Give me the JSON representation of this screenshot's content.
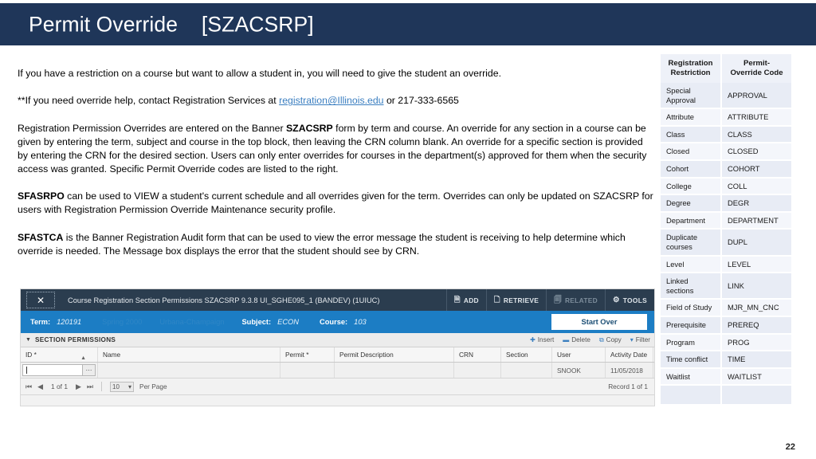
{
  "slide": {
    "title_main": "Permit Override",
    "title_code": "[SZACSRP]",
    "number": "22"
  },
  "body": {
    "p1": "If you have a restriction on a course but want to allow a student in, you will need to give the student an override.",
    "p2_pre": "**If you need override help, contact Registration Services at ",
    "p2_link": "registration@Illinois.edu",
    "p2_post": " or 217-333-6565",
    "p3_pre": "Registration Permission Overrides are entered on the Banner ",
    "p3_bold": "SZACSRP",
    "p3_post": " form by term and course.  An override for any section in a course can be given by entering the term, subject and course in the top block, then leaving the CRN column blank.  An override for a specific section is provided by entering the CRN for the desired section. Users can only enter overrides for courses in the department(s) approved for them when the security access was granted. Specific Permit Override codes are listed to the right.",
    "p4_bold": "SFASRPO",
    "p4_post": " can be used to VIEW a student's current schedule and all overrides given for the term.  Overrides can only be updated on SZACSRP for users with Registration Permission Override Maintenance security profile.",
    "p5_bold": "SFASTCA",
    "p5_post": " is the Banner Registration Audit form that can be used to view the error message the student is receiving to help determine which override is needed.  The Message box displays the error that the student should see by CRN."
  },
  "code_table": {
    "headers": [
      "Registration Restriction",
      "Permit-Override Code"
    ],
    "header_lines": [
      [
        "Registration",
        "Restriction"
      ],
      [
        "Permit-",
        "Override Code"
      ]
    ],
    "rows": [
      {
        "restriction": "Special Approval",
        "code": "APPROVAL"
      },
      {
        "restriction": "Attribute",
        "code": "ATTRIBUTE"
      },
      {
        "restriction": "Class",
        "code": "CLASS"
      },
      {
        "restriction": "Closed",
        "code": "CLOSED"
      },
      {
        "restriction": "Cohort",
        "code": "COHORT"
      },
      {
        "restriction": "College",
        "code": "COLL"
      },
      {
        "restriction": "Degree",
        "code": "DEGR"
      },
      {
        "restriction": "Department",
        "code": "DEPARTMENT"
      },
      {
        "restriction": "Duplicate courses",
        "code": "DUPL"
      },
      {
        "restriction": "Level",
        "code": "LEVEL"
      },
      {
        "restriction": "Linked sections",
        "code": "LINK"
      },
      {
        "restriction": "Field of Study",
        "code": "MJR_MN_CNC"
      },
      {
        "restriction": "Prerequisite",
        "code": "PREREQ"
      },
      {
        "restriction": "Program",
        "code": "PROG"
      },
      {
        "restriction": "Time conflict",
        "code": "TIME"
      },
      {
        "restriction": "Waitlist",
        "code": "WAITLIST"
      },
      {
        "restriction": "",
        "code": ""
      }
    ]
  },
  "banner": {
    "close_glyph": "✕",
    "window_title": "Course Registration Section Permissions SZACSRP 9.3.8 UI_SGHE095_1 (BANDEV) (1UIUC)",
    "actions": [
      {
        "label": "ADD",
        "glyph": "🗎",
        "disabled": false
      },
      {
        "label": "RETRIEVE",
        "glyph": "🗋",
        "disabled": false
      },
      {
        "label": "RELATED",
        "glyph": "🗐",
        "disabled": true
      },
      {
        "label": "TOOLS",
        "glyph": "⚙",
        "disabled": false
      }
    ],
    "keyblock": {
      "term_label": "Term:",
      "term_value": "120191",
      "term_desc": "Spring 2000",
      "campus_desc": "Urbana-Champaign",
      "subject_label": "Subject:",
      "subject_value": "ECON",
      "course_label": "Course:",
      "course_value": "103",
      "start_over": "Start Over"
    },
    "section": {
      "label": "SECTION PERMISSIONS",
      "buttons": [
        {
          "label": "Insert",
          "glyph": "➕"
        },
        {
          "label": "Delete",
          "glyph": "➖"
        },
        {
          "label": "Copy",
          "glyph": "⧉"
        },
        {
          "label": "Filter",
          "glyph": "∇"
        }
      ]
    },
    "grid": {
      "columns": [
        "ID *",
        "Name",
        "Permit *",
        "Permit Description",
        "CRN",
        "Section",
        "User",
        "Activity Date"
      ],
      "row": {
        "id": "",
        "name": "",
        "permit": "",
        "permit_description": "",
        "crn": "",
        "section": "",
        "user": "SNOOK",
        "activity_date": "11/05/2018"
      }
    },
    "pager": {
      "first": "⏮",
      "prev": "◀",
      "page_text": "1 of 1",
      "next": "▶",
      "last": "⏭",
      "per_page_value": "10",
      "per_page_label": "Per Page",
      "record_text": "Record 1 of 1"
    }
  }
}
